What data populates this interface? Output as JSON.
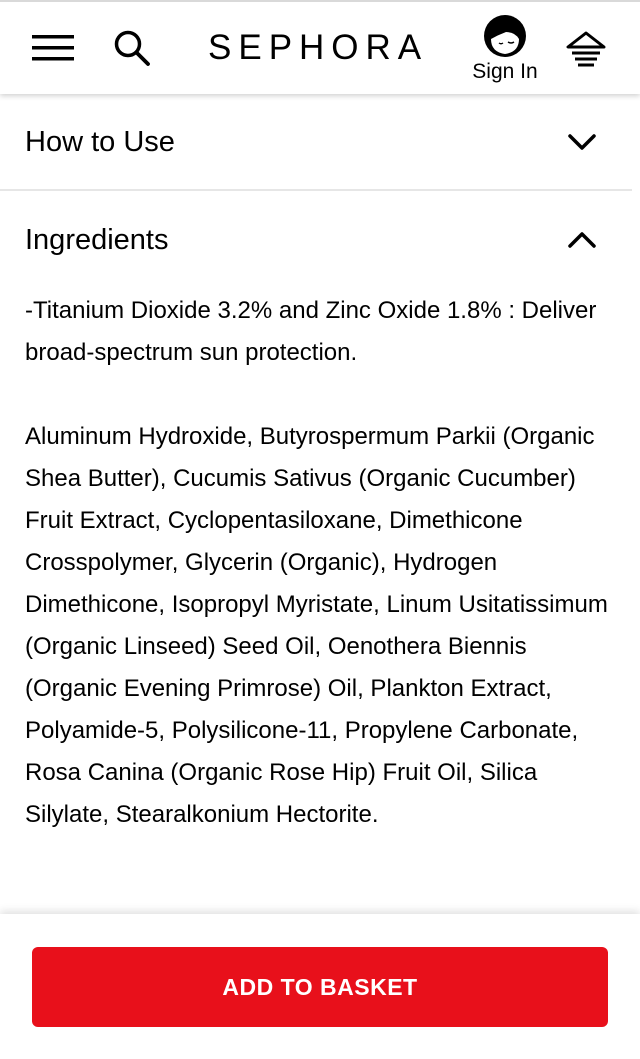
{
  "header": {
    "logo": "SEPHORA",
    "sign_in_label": "Sign In",
    "icons": {
      "menu": "hamburger-menu-icon",
      "search": "search-icon",
      "avatar": "user-avatar-icon",
      "basket": "basket-icon"
    }
  },
  "sections": [
    {
      "title": "How to Use",
      "expanded": false
    },
    {
      "title": "Ingredients",
      "expanded": true
    }
  ],
  "ingredients": {
    "highlight": "-Titanium Dioxide 3.2% and Zinc Oxide 1.8% : Deliver broad-spectrum sun protection.",
    "full_list": "Aluminum Hydroxide, Butyrospermum Parkii (Organic Shea Butter), Cucumis Sativus (Organic Cucumber) Fruit Extract, Cyclopentasiloxane, Dimethicone Crosspolymer, Glycerin (Organic), Hydrogen Dimethicone, Isopropyl Myristate, Linum Usitatissimum (Organic Linseed) Seed Oil, Oenothera Biennis (Organic Evening Primrose) Oil, Plankton Extract, Polyamide-5, Polysilicone-11, Propylene Carbonate, Rosa Canina (Organic Rose Hip) Fruit Oil, Silica Silylate, Stearalkonium Hectorite."
  },
  "cta": {
    "add_to_basket": "ADD TO BASKET",
    "color": "#e8101b"
  }
}
